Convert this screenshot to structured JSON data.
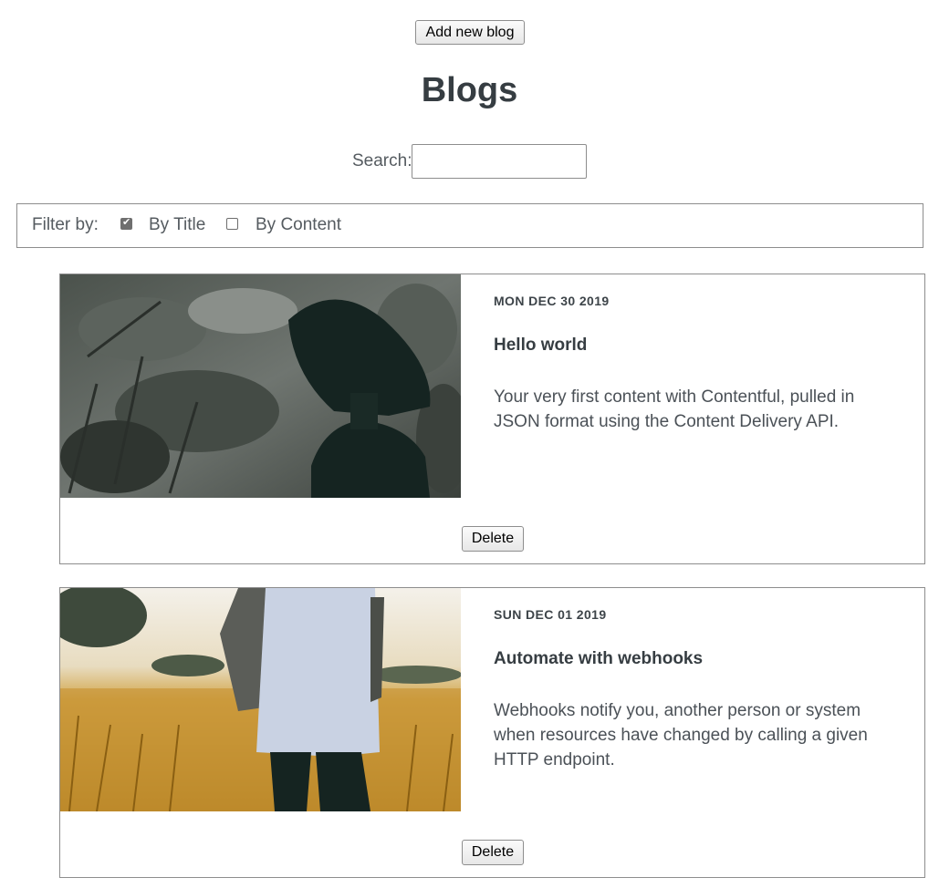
{
  "header": {
    "add_label": "Add new blog",
    "title": "Blogs"
  },
  "search": {
    "label": "Search:",
    "value": ""
  },
  "filter": {
    "label": "Filter by:",
    "options": [
      {
        "label": "By Title",
        "checked": true
      },
      {
        "label": "By Content",
        "checked": false
      }
    ]
  },
  "posts": [
    {
      "date": "MON DEC 30 2019",
      "title": "Hello world",
      "body": "Your very first content with Contentful, pulled in JSON format using the Content Delivery API.",
      "delete_label": "Delete",
      "image": "woman-in-black-hat-forest-photo"
    },
    {
      "date": "SUN DEC 01 2019",
      "title": "Automate with webhooks",
      "body": "Webhooks notify you, another person or system when resources have changed by calling a given HTTP endpoint.",
      "delete_label": "Delete",
      "image": "person-in-golden-field-photo"
    }
  ]
}
